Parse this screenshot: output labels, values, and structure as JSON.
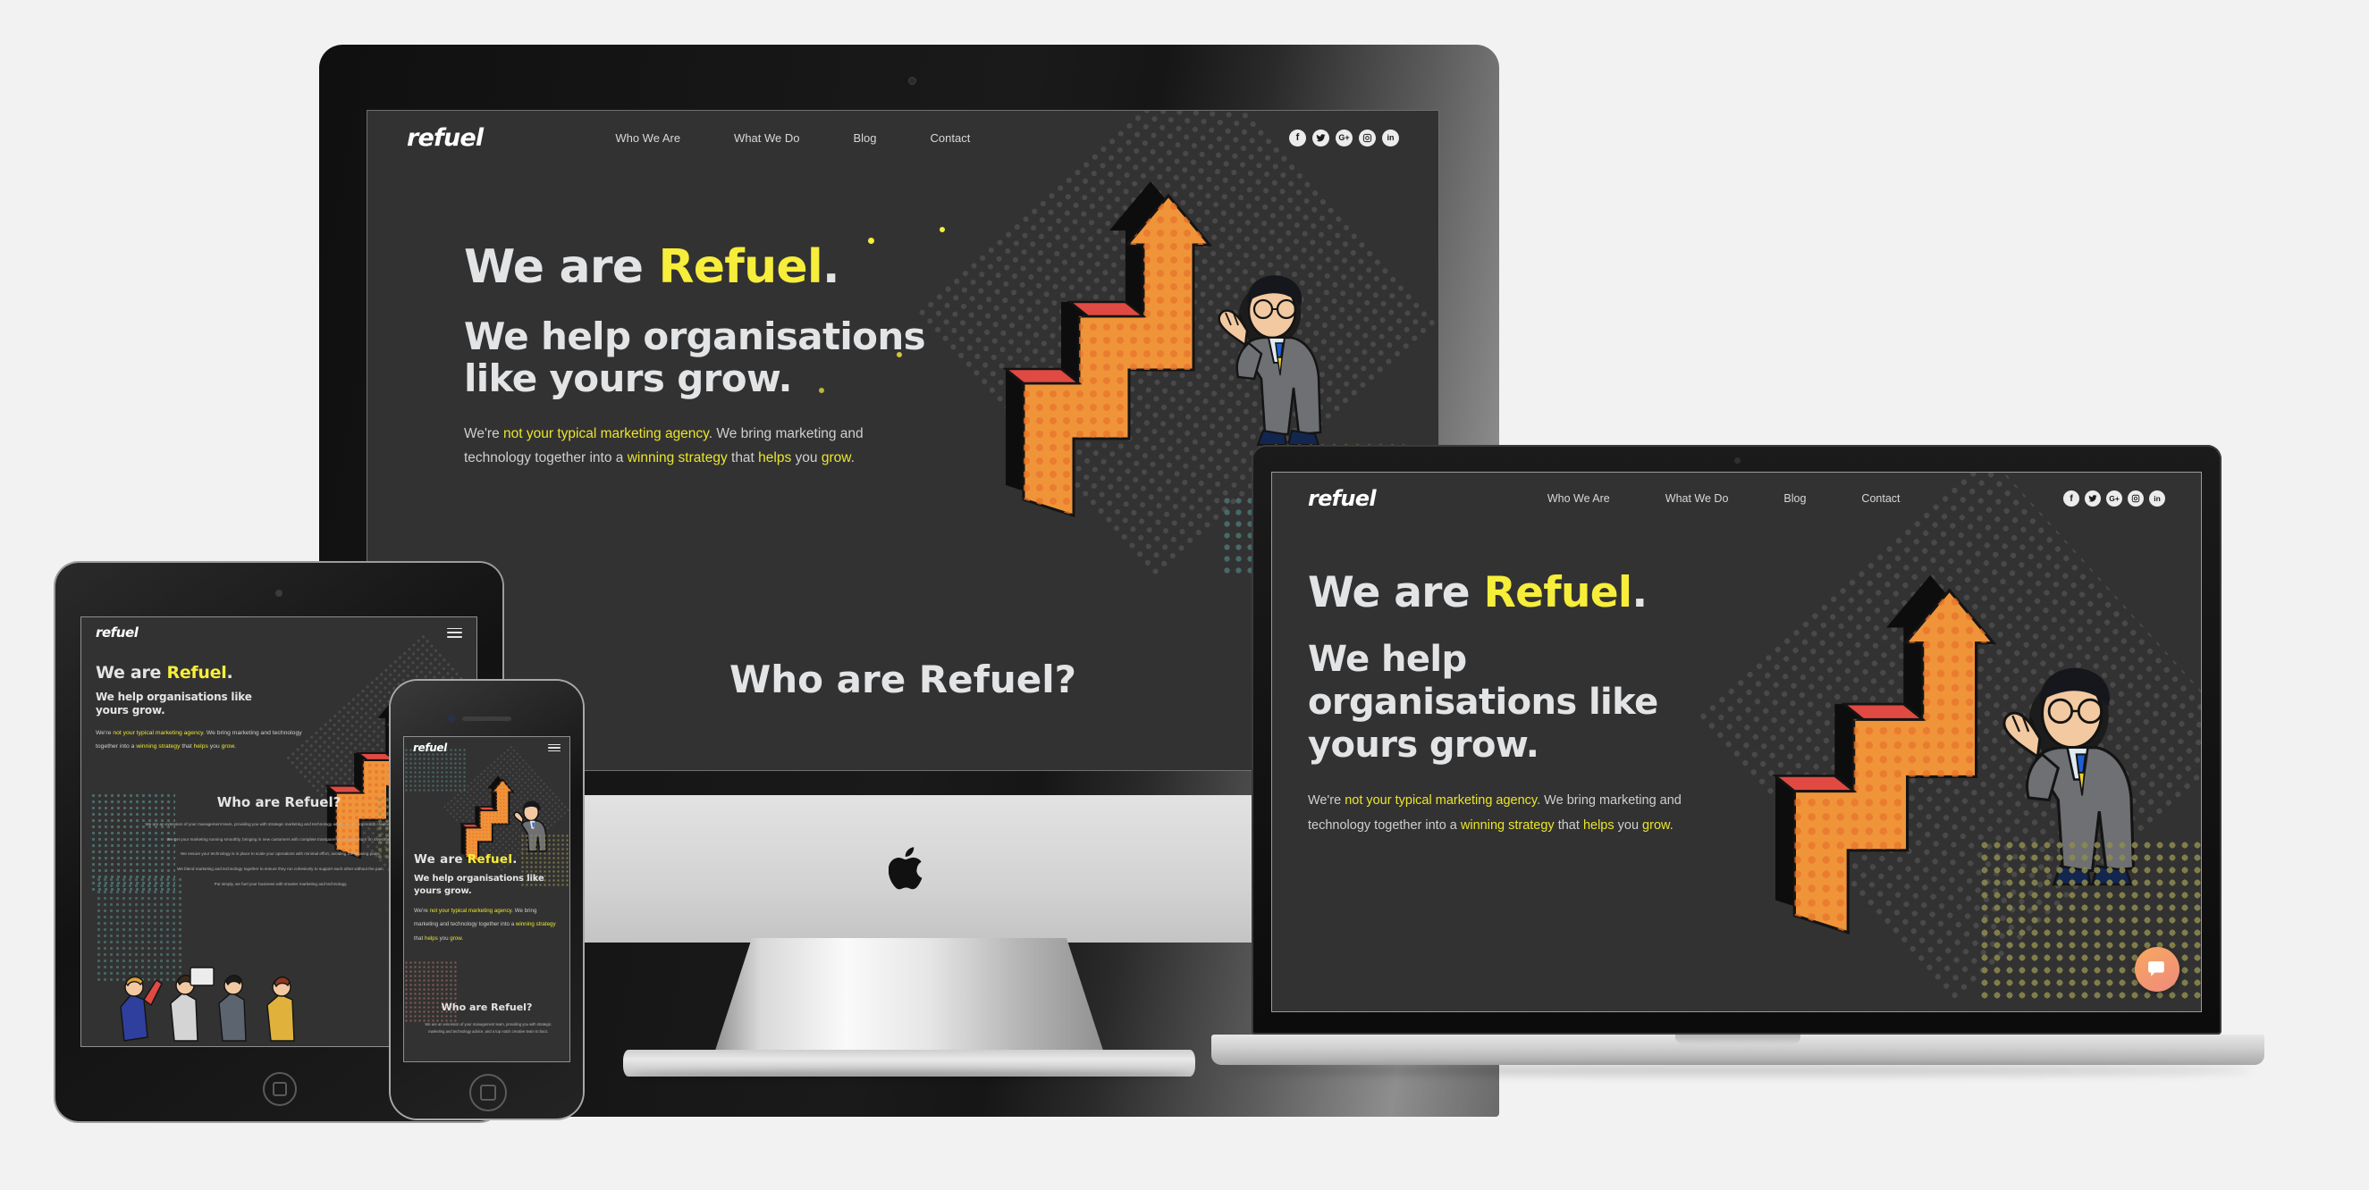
{
  "page": {
    "background_color": "#f2f2f2",
    "site_background": "#333232",
    "accent_yellow": "#f6ee3a",
    "text_light": "#e2e4e6"
  },
  "brand": {
    "logo": "refuel"
  },
  "nav": {
    "items": [
      {
        "label": "Who We Are"
      },
      {
        "label": "What We Do"
      },
      {
        "label": "Blog"
      },
      {
        "label": "Contact"
      }
    ],
    "socials": [
      {
        "name": "facebook-icon",
        "glyph": "f"
      },
      {
        "name": "twitter-icon",
        "glyph": "t"
      },
      {
        "name": "google-plus-icon",
        "glyph": "G+"
      },
      {
        "name": "instagram-icon",
        "glyph": "ig"
      },
      {
        "name": "linkedin-icon",
        "glyph": "in"
      }
    ],
    "menu_icon": "hamburger-icon"
  },
  "hero": {
    "line1_plain": "We are ",
    "line1_accent": "Refuel",
    "line1_period": ".",
    "line2": "We help organisations",
    "line3": "like yours grow.",
    "line2_laptop": "We help",
    "line3_laptop": "organisations like",
    "line4_laptop": "yours grow.",
    "line2_small": "We help organisations like",
    "line3_small": "yours grow.",
    "paragraph": {
      "p1": "We're ",
      "a1": "not your typical marketing agency",
      "p2": ". We bring marketing and technology together into a ",
      "a2": "winning strategy",
      "p3": " that ",
      "a3": "helps",
      "p4": " you ",
      "a4": "grow",
      "p5": "."
    }
  },
  "section": {
    "title": "Who are Refuel?",
    "paragraphs": [
      "We are an extension of your management team, providing you with strategic marketing and technology advice, and a top notch creative team to boot.",
      "We get your marketing running smoothly, bringing in new customers with complete transparency of your return on investment.",
      "We ensure your technology is in place to scale your operations with minimal effort, avoiding the growing pains.",
      "We blend marketing and technology together to ensure they run cohesively to support each other without the pain.",
      "Put simply, we fuel your business with smarter marketing and technology."
    ]
  },
  "widgets": {
    "chat": {
      "name": "chat-bubble-button",
      "color": "#f39a6c"
    }
  },
  "devices": [
    {
      "name": "imac-desktop",
      "type": "desktop"
    },
    {
      "name": "macbook-laptop",
      "type": "laptop"
    },
    {
      "name": "ipad-tablet",
      "type": "tablet"
    },
    {
      "name": "iphone-mobile",
      "type": "mobile"
    }
  ],
  "illustration": {
    "name": "growth-arrow-businessman",
    "arrow_color": "#f0943a",
    "arrow_shadow": "#0d0d0d",
    "accent_red": "#e04a42",
    "description": "comic halftone upward zigzag arrow pushed by a businessman in a grey suit"
  }
}
